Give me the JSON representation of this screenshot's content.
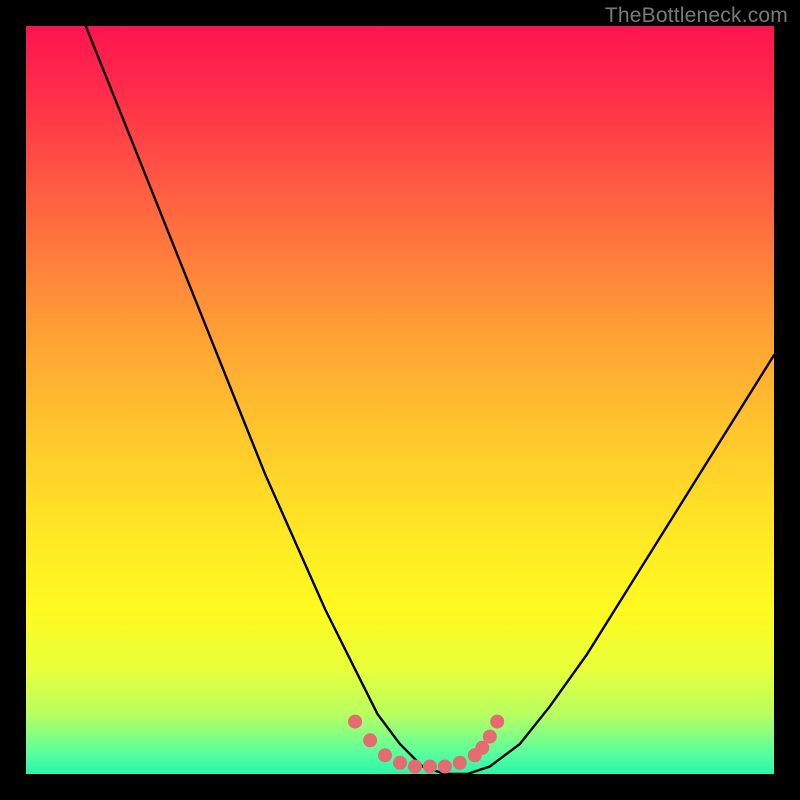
{
  "watermark": "TheBottleneck.com",
  "chart_data": {
    "type": "line",
    "title": "",
    "xlabel": "",
    "ylabel": "",
    "xlim": [
      0,
      100
    ],
    "ylim": [
      0,
      100
    ],
    "series": [
      {
        "name": "bottleneck-curve",
        "x": [
          8,
          12,
          16,
          20,
          24,
          28,
          32,
          36,
          40,
          44,
          47,
          50,
          53,
          56,
          59,
          62,
          66,
          70,
          75,
          80,
          85,
          90,
          95,
          100
        ],
        "y": [
          100,
          90,
          80,
          70,
          60,
          50,
          40,
          31,
          22,
          14,
          8,
          4,
          1,
          0,
          0,
          1,
          4,
          9,
          16,
          24,
          32,
          40,
          48,
          56
        ]
      }
    ],
    "markers": {
      "name": "highlight-markers",
      "x": [
        44,
        46,
        48,
        50,
        52,
        54,
        56,
        58,
        60,
        61,
        62,
        63
      ],
      "y": [
        7,
        4.5,
        2.5,
        1.5,
        1,
        1,
        1,
        1.5,
        2.5,
        3.5,
        5,
        7
      ]
    },
    "annotations": []
  },
  "colors": {
    "curve": "#000000",
    "markers": "#e66a6f",
    "frame": "#000000"
  }
}
